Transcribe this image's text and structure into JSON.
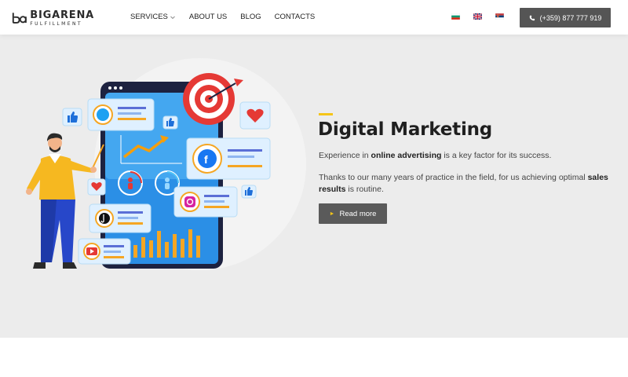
{
  "logo": {
    "brand": "BIGARENA",
    "sub": "FULFILLMENT",
    "mark_color": "#2b2b2b"
  },
  "nav": {
    "services": "SERVICES",
    "about": "ABOUT US",
    "blog": "BLOG",
    "contacts": "CONTACTS"
  },
  "languages": [
    "bg",
    "en",
    "sr"
  ],
  "phone": {
    "label": "(+359) 877 777 919",
    "icon": "phone-icon"
  },
  "hero": {
    "title": "Digital Marketing",
    "p1_before": "Experience in ",
    "p1_bold": "online advertising",
    "p1_after": " is a key factor for its success.",
    "p2_before": "Thanks to our many years of practice in the field, for us achieving optimal ",
    "p2_bold": "sales results",
    "p2_after": " is routine.",
    "button": "Read more",
    "accent_color": "#f5c518"
  },
  "colors": {
    "button_bg": "#5a5a5a",
    "hero_bg": "#ececec"
  }
}
